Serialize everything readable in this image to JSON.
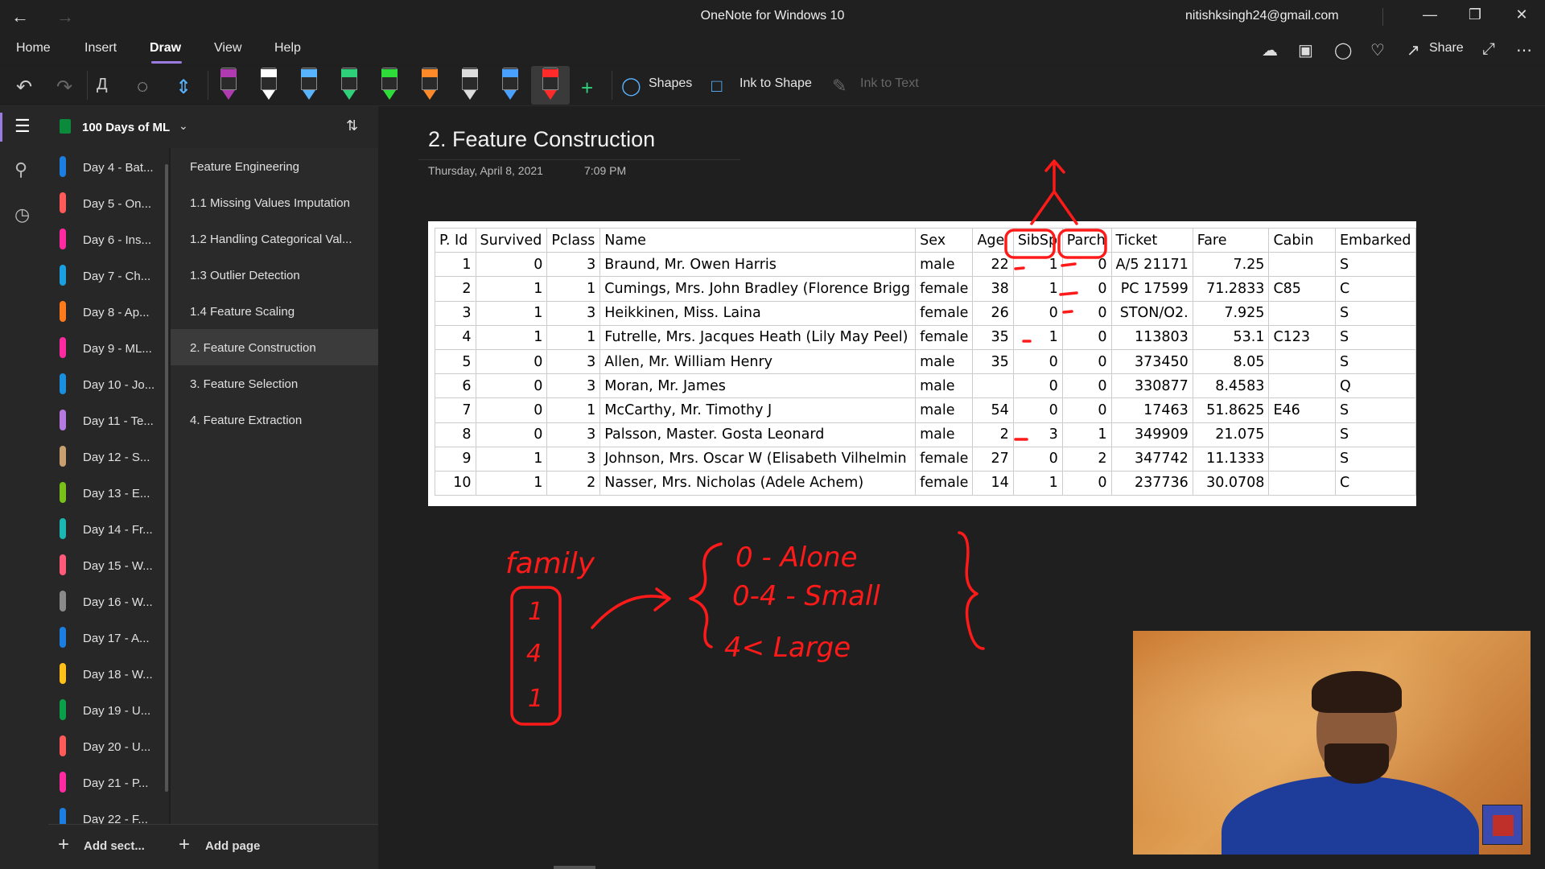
{
  "window": {
    "title": "OneNote for Windows 10",
    "account": "nitishksingh24@gmail.com"
  },
  "menu": {
    "items": [
      "Home",
      "Insert",
      "Draw",
      "View",
      "Help"
    ],
    "active": "Draw",
    "share_label": "Share"
  },
  "ribbon": {
    "shapes_label": "Shapes",
    "ink_to_shape_label": "Ink to Shape",
    "ink_to_text_label": "Ink to Text",
    "pens": [
      {
        "color": "#b03ab0"
      },
      {
        "color": "#ffffff"
      },
      {
        "color": "#59b4ff"
      },
      {
        "color": "#2fd07a"
      },
      {
        "color": "#2edc3a"
      },
      {
        "color": "#ff8a2a"
      },
      {
        "color": "#dddddd"
      },
      {
        "color": "#4aa0ff"
      },
      {
        "color": "#ff2a2a"
      }
    ]
  },
  "notebook": {
    "name": "100 Days of ML",
    "color": "#0a8a3a"
  },
  "sections": [
    {
      "label": "Day 4 - Bat...",
      "color": "#1a7fe0"
    },
    {
      "label": "Day 5 - On...",
      "color": "#ff5a5a"
    },
    {
      "label": "Day 6 - Ins...",
      "color": "#ff2aa0"
    },
    {
      "label": "Day 7 - Ch...",
      "color": "#1a9fe0"
    },
    {
      "label": "Day 8 - Ap...",
      "color": "#ff7a1a"
    },
    {
      "label": "Day 9 - ML...",
      "color": "#ff2aa0"
    },
    {
      "label": "Day 10 - Jo...",
      "color": "#1a8fe0"
    },
    {
      "label": "Day 11 - Te...",
      "color": "#b57ae0"
    },
    {
      "label": "Day 12 - S...",
      "color": "#c8a070"
    },
    {
      "label": "Day 13 - E...",
      "color": "#7ac01a"
    },
    {
      "label": "Day 14 - Fr...",
      "color": "#1ab8b0"
    },
    {
      "label": "Day 15 - W...",
      "color": "#ff5a7a"
    },
    {
      "label": "Day 16 - W...",
      "color": "#8a8a8a"
    },
    {
      "label": "Day 17 - A...",
      "color": "#1a7fe0"
    },
    {
      "label": "Day 18 - W...",
      "color": "#ffc01a"
    },
    {
      "label": "Day 19 - U...",
      "color": "#0aa04a"
    },
    {
      "label": "Day 20 - U...",
      "color": "#ff5a5a"
    },
    {
      "label": "Day 21 - P...",
      "color": "#ff2aa0"
    },
    {
      "label": "Day 22 - F...",
      "color": "#1a7fe0"
    }
  ],
  "pages": [
    {
      "label": "Feature Engineering",
      "active": false
    },
    {
      "label": "1.1 Missing Values Imputation",
      "active": false
    },
    {
      "label": "1.2 Handling Categorical Val...",
      "active": false
    },
    {
      "label": "1.3 Outlier Detection",
      "active": false
    },
    {
      "label": "1.4 Feature Scaling",
      "active": false
    },
    {
      "label": "2. Feature Construction",
      "active": true
    },
    {
      "label": "3. Feature Selection",
      "active": false
    },
    {
      "label": "4. Feature Extraction",
      "active": false
    }
  ],
  "bottom": {
    "add_section": "Add sect...",
    "add_page": "Add page"
  },
  "page": {
    "title": "2. Feature Construction",
    "date": "Thursday, April 8, 2021",
    "time": "7:09 PM"
  },
  "table": {
    "headers": [
      "P. Id",
      "Survived",
      "Pclass",
      "Name",
      "Sex",
      "Age",
      "SibSp",
      "Parch",
      "Ticket",
      "Fare",
      "Cabin",
      "Embarked"
    ],
    "rows": [
      [
        "1",
        "0",
        "3",
        "Braund, Mr. Owen Harris",
        "male",
        "22",
        "1",
        "0",
        "A/5 21171",
        "7.25",
        "",
        "S"
      ],
      [
        "2",
        "1",
        "1",
        "Cumings, Mrs. John Bradley (Florence Brigg",
        "female",
        "38",
        "1",
        "0",
        "PC 17599",
        "71.2833",
        "C85",
        "C"
      ],
      [
        "3",
        "1",
        "3",
        "Heikkinen, Miss. Laina",
        "female",
        "26",
        "0",
        "0",
        "STON/O2.",
        "7.925",
        "",
        "S"
      ],
      [
        "4",
        "1",
        "1",
        "Futrelle, Mrs. Jacques Heath (Lily May Peel)",
        "female",
        "35",
        "1",
        "0",
        "113803",
        "53.1",
        "C123",
        "S"
      ],
      [
        "5",
        "0",
        "3",
        "Allen, Mr. William Henry",
        "male",
        "35",
        "0",
        "0",
        "373450",
        "8.05",
        "",
        "S"
      ],
      [
        "6",
        "0",
        "3",
        "Moran, Mr. James",
        "male",
        "",
        "0",
        "0",
        "330877",
        "8.4583",
        "",
        "Q"
      ],
      [
        "7",
        "0",
        "1",
        "McCarthy, Mr. Timothy J",
        "male",
        "54",
        "0",
        "0",
        "17463",
        "51.8625",
        "E46",
        "S"
      ],
      [
        "8",
        "0",
        "3",
        "Palsson, Master. Gosta Leonard",
        "male",
        "2",
        "3",
        "1",
        "349909",
        "21.075",
        "",
        "S"
      ],
      [
        "9",
        "1",
        "3",
        "Johnson, Mrs. Oscar W (Elisabeth Vilhelmin",
        "female",
        "27",
        "0",
        "2",
        "347742",
        "11.1333",
        "",
        "S"
      ],
      [
        "10",
        "1",
        "2",
        "Nasser, Mrs. Nicholas (Adele Achem)",
        "female",
        "14",
        "1",
        "0",
        "237736",
        "30.0708",
        "",
        "C"
      ]
    ]
  },
  "ink": {
    "color": "#ff1a1a",
    "family_label": "family",
    "family_values": [
      "1",
      "4",
      "1"
    ],
    "rule_1": "0 - Alone",
    "rule_2": "0-4 - Small",
    "rule_3": "4<   Large"
  }
}
